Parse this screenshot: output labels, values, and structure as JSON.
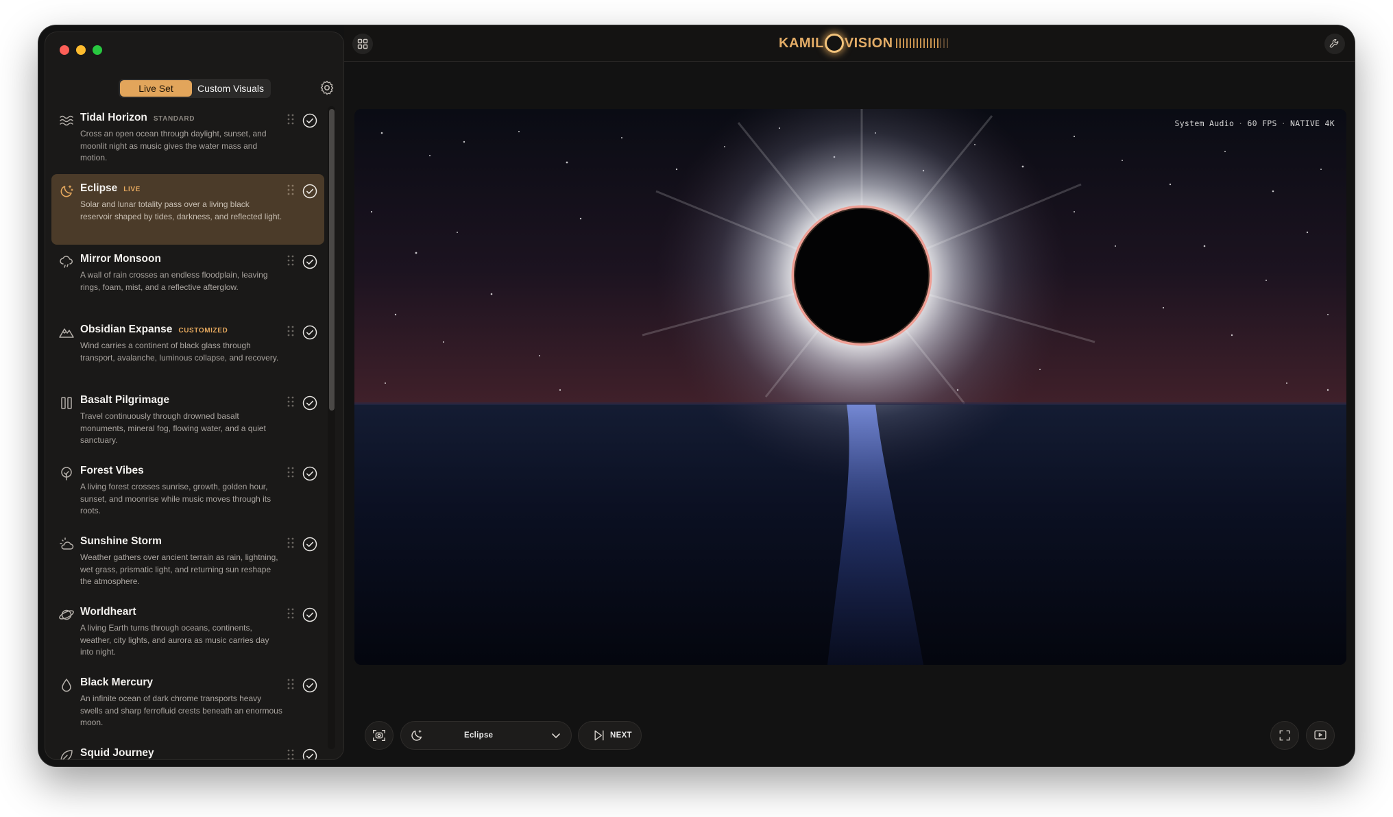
{
  "logo": {
    "text_left": "KAMIL",
    "text_right": "VISION"
  },
  "sidebar": {
    "tabs": [
      {
        "label": "Live Set",
        "active": true
      },
      {
        "label": "Custom Visuals",
        "active": false
      }
    ],
    "items": [
      {
        "title": "Tidal Horizon",
        "badge": "STANDARD",
        "desc": "Cross an open ocean through daylight, sunset, and moonlit night as music gives the water mass and motion.",
        "icon": "waves-icon"
      },
      {
        "title": "Eclipse",
        "badge": "LIVE",
        "desc": "Solar and lunar totality pass over a living black reservoir shaped by tides, darkness, and reflected light.",
        "icon": "moon-icon"
      },
      {
        "title": "Mirror Monsoon",
        "badge": "",
        "desc": "A wall of rain crosses an endless floodplain, leaving rings, foam, mist, and a reflective afterglow.",
        "icon": "cloud-rain-icon"
      },
      {
        "title": "Obsidian Expanse",
        "badge": "CUSTOMIZED",
        "desc": "Wind carries a continent of black glass through transport, avalanche, luminous collapse, and recovery.",
        "icon": "mountain-icon"
      },
      {
        "title": "Basalt Pilgrimage",
        "badge": "",
        "desc": "Travel continuously through drowned basalt monuments, mineral fog, flowing water, and a quiet sanctuary.",
        "icon": "columns-icon"
      },
      {
        "title": "Forest Vibes",
        "badge": "",
        "desc": "A living forest crosses sunrise, growth, golden hour, sunset, and moonrise while music moves through its roots.",
        "icon": "tree-icon"
      },
      {
        "title": "Sunshine Storm",
        "badge": "",
        "desc": "Weather gathers over ancient terrain as rain, lightning, wet grass, prismatic light, and returning sun reshape the atmosphere.",
        "icon": "sun-cloud-icon"
      },
      {
        "title": "Worldheart",
        "badge": "",
        "desc": "A living Earth turns through oceans, continents, weather, city lights, and aurora as music carries day into night.",
        "icon": "planet-icon"
      },
      {
        "title": "Black Mercury",
        "badge": "",
        "desc": "An infinite ocean of dark chrome transports heavy swells and sharp ferrofluid crests beneath an enormous moon.",
        "icon": "droplet-icon"
      },
      {
        "title": "Squid Journey",
        "badge": "",
        "desc": "",
        "icon": "leaf-icon"
      }
    ]
  },
  "viewport": {
    "audio_source": "System Audio",
    "fps": "60 FPS",
    "resolution": "NATIVE 4K"
  },
  "controls": {
    "current_visual": "Eclipse",
    "next_label": "NEXT"
  },
  "colors": {
    "accent": "#e2a55b",
    "live_bg": "#4b3b29"
  }
}
